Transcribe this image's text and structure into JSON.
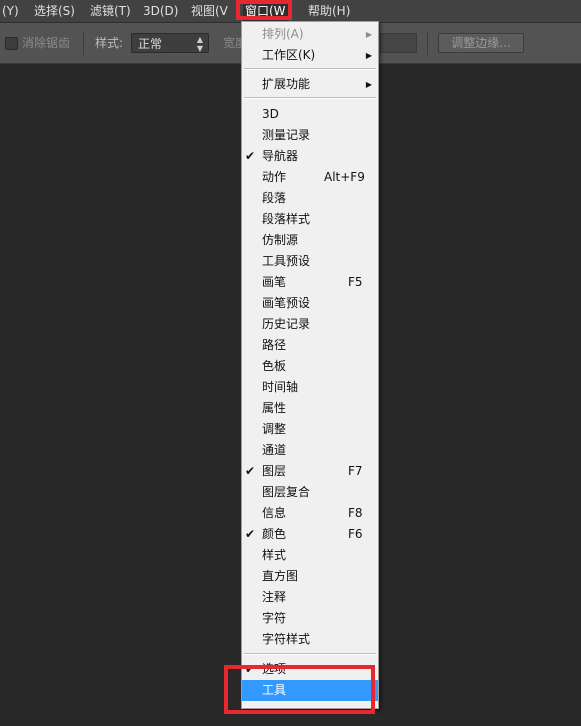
{
  "menubar": {
    "items": [
      {
        "text": "(Y)",
        "name": "menu-image-partial"
      },
      {
        "text": "选择(S)",
        "name": "menu-select"
      },
      {
        "text": "滤镜(T)",
        "name": "menu-filter"
      },
      {
        "text": "3D(D)",
        "name": "menu-3d"
      },
      {
        "text": "视图(V",
        "name": "menu-view"
      },
      {
        "text": "窗口(W",
        "name": "menu-window"
      },
      {
        "text": "帮助(H)",
        "name": "menu-help"
      }
    ]
  },
  "options": {
    "antialias_label": "消除锯齿",
    "style_label": "样式:",
    "style_value": "正常",
    "width_label": "宽度",
    "refine_edge_label": "调整边缘..."
  },
  "dropdown": {
    "items": [
      {
        "label": "排列(A)",
        "shortcut": "",
        "checked": false,
        "submenu": true,
        "disabled": true
      },
      {
        "label": "工作区(K)",
        "shortcut": "",
        "checked": false,
        "submenu": true,
        "disabled": false
      },
      {
        "label": "扩展功能",
        "shortcut": "",
        "checked": false,
        "submenu": true,
        "disabled": false
      },
      {
        "label": "3D",
        "shortcut": "",
        "checked": false
      },
      {
        "label": "测量记录",
        "shortcut": "",
        "checked": false
      },
      {
        "label": "导航器",
        "shortcut": "",
        "checked": true
      },
      {
        "label": "动作",
        "shortcut": "Alt+F9",
        "checked": false
      },
      {
        "label": "段落",
        "shortcut": "",
        "checked": false
      },
      {
        "label": "段落样式",
        "shortcut": "",
        "checked": false
      },
      {
        "label": "仿制源",
        "shortcut": "",
        "checked": false
      },
      {
        "label": "工具预设",
        "shortcut": "",
        "checked": false
      },
      {
        "label": "画笔",
        "shortcut": "F5",
        "checked": false
      },
      {
        "label": "画笔预设",
        "shortcut": "",
        "checked": false
      },
      {
        "label": "历史记录",
        "shortcut": "",
        "checked": false
      },
      {
        "label": "路径",
        "shortcut": "",
        "checked": false
      },
      {
        "label": "色板",
        "shortcut": "",
        "checked": false
      },
      {
        "label": "时间轴",
        "shortcut": "",
        "checked": false
      },
      {
        "label": "属性",
        "shortcut": "",
        "checked": false
      },
      {
        "label": "调整",
        "shortcut": "",
        "checked": false
      },
      {
        "label": "通道",
        "shortcut": "",
        "checked": false
      },
      {
        "label": "图层",
        "shortcut": "F7",
        "checked": true
      },
      {
        "label": "图层复合",
        "shortcut": "",
        "checked": false
      },
      {
        "label": "信息",
        "shortcut": "F8",
        "checked": false
      },
      {
        "label": "颜色",
        "shortcut": "F6",
        "checked": true
      },
      {
        "label": "样式",
        "shortcut": "",
        "checked": false
      },
      {
        "label": "直方图",
        "shortcut": "",
        "checked": false
      },
      {
        "label": "注释",
        "shortcut": "",
        "checked": false
      },
      {
        "label": "字符",
        "shortcut": "",
        "checked": false
      },
      {
        "label": "字符样式",
        "shortcut": "",
        "checked": false
      },
      {
        "label": "选项",
        "shortcut": "",
        "checked": true
      },
      {
        "label": "工具",
        "shortcut": "",
        "checked": false,
        "highlighted": true
      }
    ]
  },
  "colors": {
    "highlight": "#3399ff",
    "annotation_red": "#e8282f"
  }
}
